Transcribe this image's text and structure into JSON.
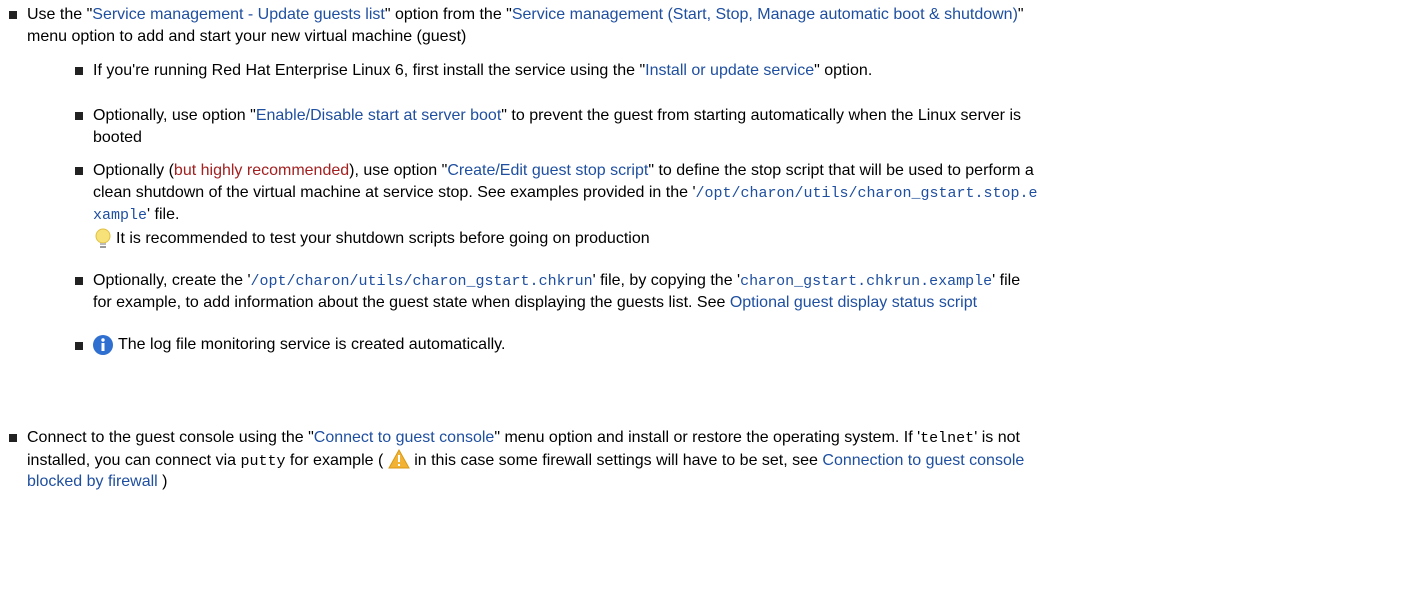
{
  "items": [
    {
      "line1": {
        "t1": "Use the \"",
        "l1": "Service management - Update guests list",
        "t2": "\" option from the \"",
        "l2": "Service management (Start, Stop, Manage automatic boot & shutdown)",
        "t3": "\""
      },
      "line2": "menu option to add and start your new virtual machine (guest)"
    }
  ],
  "sub": [
    {
      "t1": "If you're running Red Hat Enterprise Linux 6, first install the service using the \"",
      "l1": "Install or update service",
      "t2": "\" option."
    },
    {
      "t1": "Optionally, use option \"",
      "l1": "Enable/Disable start at server boot",
      "t2": "\" to prevent the guest from starting automatically when the Linux server is",
      "line2": "booted"
    },
    {
      "t1": "Optionally (",
      "r1": "but highly recommended",
      "t2": "), use option \"",
      "l1": "Create/Edit guest stop script",
      "t3": "\" to define the stop script that will be used to perform a",
      "line2a": "clean shutdown of the virtual machine at service stop. See examples provided in the '",
      "code1": "/opt/charon/utils/charon_gstart.stop.e",
      "line2b": "",
      "code2": "xample",
      "line3b": "' file.",
      "tip": "It is recommended to test your shutdown scripts before going on production"
    },
    {
      "t1": "Optionally, create the '",
      "code1": "/opt/charon/utils/charon_gstart.chkrun",
      "t2": "' file, by copying the '",
      "code2": "charon_gstart.chkrun.example",
      "t3": "' file",
      "line2": "for example, to add information about the guest state when displaying the guests list. See ",
      "l1": "Optional guest display status script"
    },
    {
      "t1": "The log file monitoring service is created automatically."
    }
  ],
  "last": {
    "t1": "Connect to the guest console using the \"",
    "l1": "Connect to guest console",
    "t2": "\" menu option and install or restore the operating system. If '",
    "code1": "telnet",
    "t3": "' is not",
    "t4": "installed, you can connect via ",
    "code2": "putty",
    "t5": " for example ( ",
    "t6": " in this case some firewall settings will have to be set, see ",
    "l2": "Connection to guest console",
    "l3": "blocked by firewall",
    "t7": " )"
  }
}
